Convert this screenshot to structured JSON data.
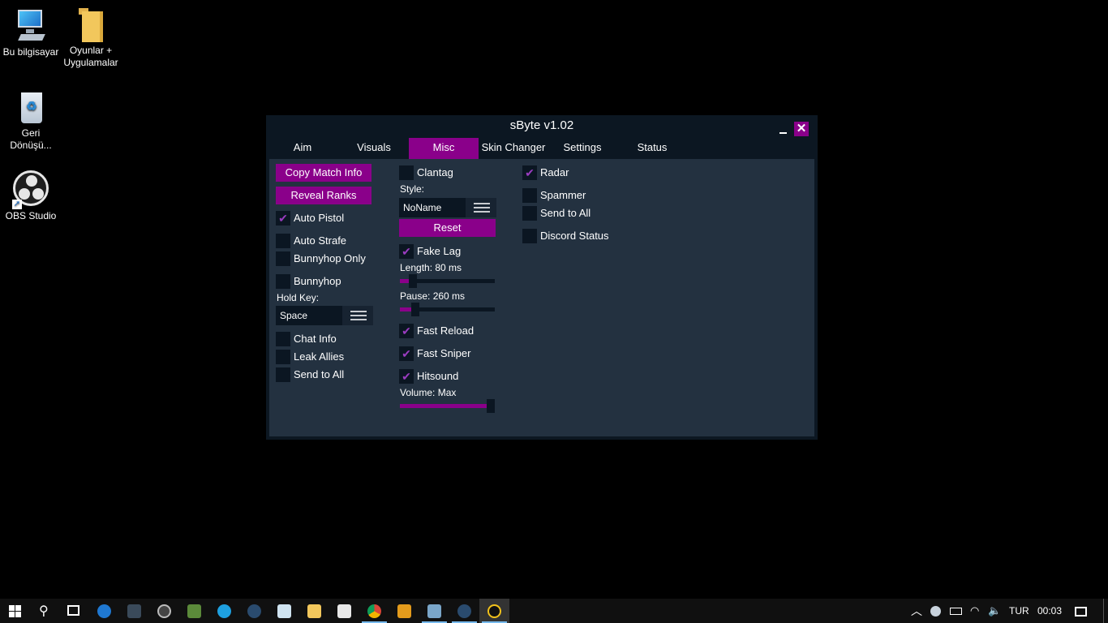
{
  "desktop": {
    "icons": [
      {
        "label": "Bu bilgisayar",
        "icon": "computer-icon"
      },
      {
        "label": "Oyunlar +\nUygulamalar",
        "label_line1": "Oyunlar +",
        "label_line2": "Uygulamalar",
        "icon": "folder-icon"
      },
      {
        "label_line1": "Geri",
        "label_line2": "Dönüşü...",
        "icon": "recycle-bin-icon"
      },
      {
        "label": "OBS Studio",
        "icon": "obs-icon"
      }
    ]
  },
  "app": {
    "title": "sByte v1.02",
    "minimize_glyph": "",
    "close_glyph": "✕",
    "accent_color": "#8a008a",
    "tabs": [
      "Aim",
      "Visuals",
      "Misc",
      "Skin Changer",
      "Settings",
      "Status"
    ],
    "active_tab": "Misc",
    "col1": {
      "copy_match_info": "Copy Match Info",
      "reveal_ranks": "Reveal Ranks",
      "auto_pistol": {
        "label": "Auto Pistol",
        "checked": true
      },
      "auto_strafe": {
        "label": "Auto Strafe",
        "checked": false
      },
      "bunnyhop_only": {
        "label": "Bunnyhop Only",
        "checked": false
      },
      "bunnyhop": {
        "label": "Bunnyhop",
        "checked": false
      },
      "hold_key_label": "Hold Key:",
      "hold_key_value": "Space",
      "chat_info": {
        "label": "Chat Info",
        "checked": false
      },
      "leak_allies": {
        "label": "Leak Allies",
        "checked": false
      },
      "send_to_all": {
        "label": "Send to All",
        "checked": false
      }
    },
    "col2": {
      "clantag": {
        "label": "Clantag",
        "checked": false
      },
      "style_label": "Style:",
      "style_value": "NoName",
      "reset": "Reset",
      "fake_lag": {
        "label": "Fake Lag",
        "checked": true
      },
      "length_label": "Length: 80 ms",
      "length_fraction": 0.1,
      "pause_label": "Pause: 260 ms",
      "pause_fraction": 0.13,
      "fast_reload": {
        "label": "Fast Reload",
        "checked": true
      },
      "fast_sniper": {
        "label": "Fast Sniper",
        "checked": true
      },
      "hitsound": {
        "label": "Hitsound",
        "checked": true
      },
      "volume_label": "Volume: Max",
      "volume_fraction": 1.0
    },
    "col3": {
      "radar": {
        "label": "Radar",
        "checked": true
      },
      "spammer": {
        "label": "Spammer",
        "checked": false
      },
      "send_to_all": {
        "label": "Send to All",
        "checked": false
      },
      "discord_status": {
        "label": "Discord Status",
        "checked": false
      }
    },
    "check_glyph": "✔"
  },
  "taskbar": {
    "language": "TUR",
    "clock": "00:03",
    "items": [
      "start-icon",
      "search-icon",
      "task-view-icon",
      "edge-icon",
      "app-icon",
      "obs-icon",
      "minecraft-icon",
      "skype-icon",
      "steam-icon",
      "notepad-icon",
      "file-explorer-icon",
      "store-icon",
      "chrome-icon",
      "csgo-icon",
      "remote-desktop-icon",
      "steam-icon",
      "sbyte-icon"
    ]
  }
}
